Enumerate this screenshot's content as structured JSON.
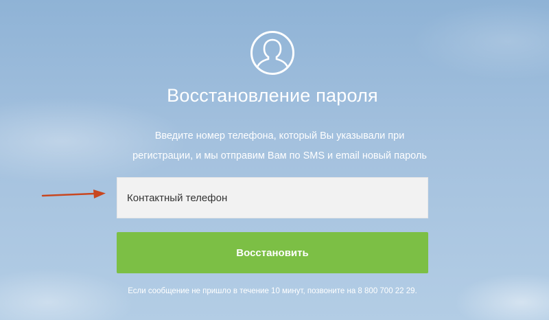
{
  "header": {
    "avatar_icon": "user-avatar-icon",
    "title": "Восстановление пароля"
  },
  "form": {
    "description_line1": "Введите номер телефона, который Вы указывали при",
    "description_line2": "регистрации, и мы отправим Вам по SMS и email новый пароль",
    "phone_placeholder": "Контактный телефон",
    "phone_value": "",
    "submit_label": "Восстановить"
  },
  "footer": {
    "note": "Если сообщение не пришло в течение 10 минут, позвоните на 8 800 700 22 29."
  },
  "annotation": {
    "arrow_icon": "arrow-right-icon",
    "arrow_color": "#c8461f"
  },
  "colors": {
    "background": "#a4c1de",
    "button": "#7cbf45",
    "input_background": "#f2f2f2",
    "text_light": "#ffffff"
  }
}
